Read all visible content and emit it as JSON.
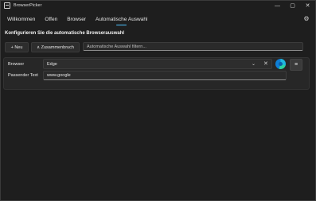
{
  "window": {
    "title": "BrowserPicker",
    "controls": {
      "minimize": "—",
      "maximize": "▢",
      "close": "✕"
    }
  },
  "tabs": [
    {
      "label": "Willkommen",
      "active": false
    },
    {
      "label": "Offen",
      "active": false
    },
    {
      "label": "Browser",
      "active": false
    },
    {
      "label": "Automatische Auswahl",
      "active": true
    }
  ],
  "settings_icon": "⚙",
  "section": {
    "title": "Konfigurieren Sie die automatische Browserauswahl"
  },
  "toolbar": {
    "new_label": "+ Neu",
    "collapse_label": "∧ Zusammenbruch",
    "filter_placeholder": "Automatische Auswahl filtern..."
  },
  "rule": {
    "browser_label": "Browser",
    "browser_value": "Edge",
    "chevron": "⌄",
    "clear": "✕",
    "browser_icon": "edge-icon",
    "menu_icon": "≡",
    "pattern_label": "Passender Text",
    "pattern_value": "www.google"
  },
  "colors": {
    "accent": "#4cc2ff",
    "background": "#1e1e1e",
    "panel": "#272727"
  }
}
